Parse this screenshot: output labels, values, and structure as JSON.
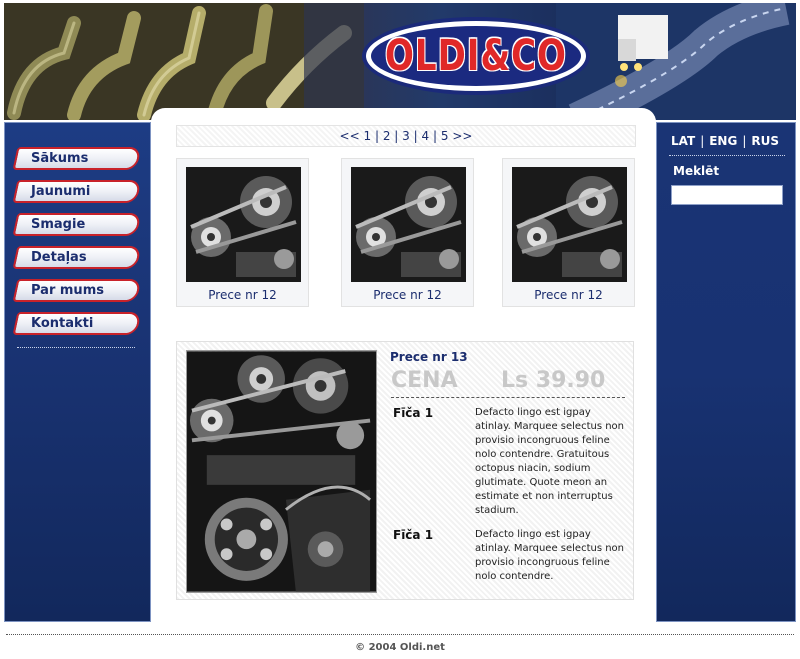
{
  "header": {
    "logo_text": "OLDI&CO"
  },
  "nav": {
    "items": [
      {
        "label": "Sākums"
      },
      {
        "label": "Jaunumi"
      },
      {
        "label": "Smagie"
      },
      {
        "label": "Detaļas"
      },
      {
        "label": "Par mums"
      },
      {
        "label": "Kontakti"
      }
    ]
  },
  "right": {
    "langs": [
      "LAT",
      "ENG",
      "RUS"
    ],
    "search_label": "Meklēt",
    "search_value": ""
  },
  "pager": {
    "prev": "<<",
    "pages": [
      "1",
      "2",
      "3",
      "4",
      "5"
    ],
    "next": ">>"
  },
  "thumbs": [
    {
      "caption": "Prece nr 12"
    },
    {
      "caption": "Prece nr 12"
    },
    {
      "caption": "Prece nr 12"
    }
  ],
  "detail": {
    "title": "Prece nr 13",
    "price_label": "CENA",
    "price_value": "Ls 39.90",
    "features": [
      {
        "name": "Fīča 1",
        "desc": "Defacto lingo est igpay atinlay. Marquee selectus non provisio incongruous feline nolo contendre. Gratuitous octopus niacin, sodium glutimate. Quote meon an estimate et non interruptus stadium."
      },
      {
        "name": "Fīča 1",
        "desc": "Defacto lingo est igpay atinlay. Marquee selectus non provisio incongruous feline nolo contendre."
      }
    ]
  },
  "footer": {
    "copyright": "© 2004 Oldi.net"
  },
  "colors": {
    "brand_red": "#e02828",
    "brand_blue": "#1b2a80",
    "sidebar_blue": "#1a3475",
    "link_blue": "#1b2d6e"
  }
}
